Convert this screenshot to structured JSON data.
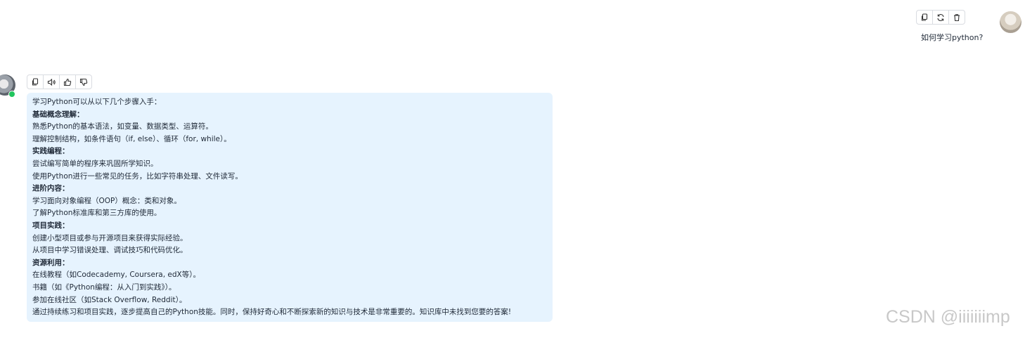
{
  "user": {
    "message": "如何学习python?",
    "toolbar": [
      "copy-icon",
      "refresh-icon",
      "trash-icon"
    ]
  },
  "assistant": {
    "toolbar": [
      "copy-icon",
      "speaker-icon",
      "thumbs-up-icon",
      "thumbs-down-icon"
    ],
    "status_color": "#22c55e",
    "bubble_color": "#e6f3fe",
    "lines": [
      {
        "text": "学习Python可以从以下几个步骤入手：",
        "bold": false
      },
      {
        "text": "基础概念理解：",
        "bold": true
      },
      {
        "text": "熟悉Python的基本语法，如变量、数据类型、运算符。",
        "bold": false
      },
      {
        "text": "理解控制结构，如条件语句（if, else）、循环（for, while）。",
        "bold": false
      },
      {
        "text": "实践编程：",
        "bold": true
      },
      {
        "text": "尝试编写简单的程序来巩固所学知识。",
        "bold": false
      },
      {
        "text": "使用Python进行一些常见的任务，比如字符串处理、文件读写。",
        "bold": false
      },
      {
        "text": "进阶内容：",
        "bold": true
      },
      {
        "text": "学习面向对象编程（OOP）概念：类和对象。",
        "bold": false
      },
      {
        "text": "了解Python标准库和第三方库的使用。",
        "bold": false
      },
      {
        "text": "项目实践：",
        "bold": true
      },
      {
        "text": "创建小型项目或参与开源项目来获得实际经验。",
        "bold": false
      },
      {
        "text": "从项目中学习错误处理、调试技巧和代码优化。",
        "bold": false
      },
      {
        "text": "资源利用：",
        "bold": true
      },
      {
        "text": "在线教程（如Codecademy, Coursera, edX等）。",
        "bold": false
      },
      {
        "text": "书籍（如《Python编程：从入门到实践》）。",
        "bold": false
      },
      {
        "text": "参加在线社区（如Stack Overflow, Reddit）。",
        "bold": false
      },
      {
        "text": "通过持续练习和项目实践，逐步提高自己的Python技能。同时，保持好奇心和不断探索新的知识与技术是非常重要的。知识库中未找到您要的答案!",
        "bold": false
      }
    ]
  },
  "watermark": "CSDN @iiiiiiimp"
}
